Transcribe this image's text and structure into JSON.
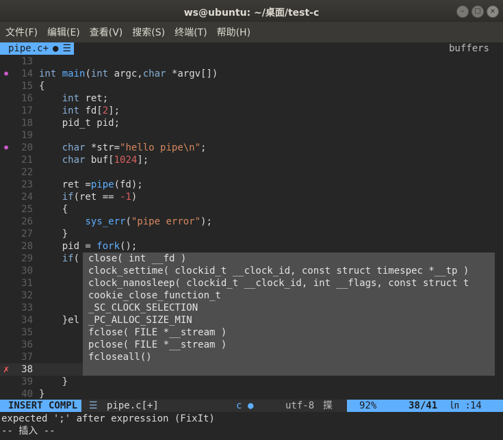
{
  "window": {
    "title": "ws@ubuntu: ~/桌面/test-c"
  },
  "menu": [
    "文件(F)",
    "编辑(E)",
    "查看(V)",
    "搜索(S)",
    "终端(T)",
    "帮助(H)"
  ],
  "tabline": {
    "active_tab": "pipe.c+",
    "right_label": "buffers"
  },
  "editor": {
    "lines": [
      {
        "num": "13",
        "sign": "",
        "tokens": []
      },
      {
        "num": "14",
        "sign": "warn",
        "tokens": [
          [
            "int ",
            "kw"
          ],
          [
            "main",
            "fn"
          ],
          [
            "(",
            "brk"
          ],
          [
            "int ",
            "kw"
          ],
          [
            "argc,",
            "t"
          ],
          [
            "char ",
            "kw"
          ],
          [
            "*argv[])",
            "t"
          ]
        ]
      },
      {
        "num": "15",
        "sign": "",
        "tokens": [
          [
            "{",
            "t"
          ]
        ]
      },
      {
        "num": "16",
        "sign": "",
        "tokens": [
          [
            "    ",
            "t"
          ],
          [
            "int ",
            "kw"
          ],
          [
            "ret;",
            "t"
          ]
        ]
      },
      {
        "num": "17",
        "sign": "",
        "tokens": [
          [
            "    ",
            "t"
          ],
          [
            "int ",
            "kw"
          ],
          [
            "fd[",
            "t"
          ],
          [
            "2",
            "num"
          ],
          [
            "];",
            "t"
          ]
        ]
      },
      {
        "num": "18",
        "sign": "",
        "tokens": [
          [
            "    pid_t pid;",
            "t"
          ]
        ]
      },
      {
        "num": "19",
        "sign": "",
        "tokens": []
      },
      {
        "num": "20",
        "sign": "warn",
        "tokens": [
          [
            "    ",
            "t"
          ],
          [
            "char ",
            "kw"
          ],
          [
            "*str=",
            "t"
          ],
          [
            "\"hello pipe\\n\"",
            "str"
          ],
          [
            ";",
            "t"
          ]
        ]
      },
      {
        "num": "21",
        "sign": "",
        "tokens": [
          [
            "    ",
            "t"
          ],
          [
            "char ",
            "kw"
          ],
          [
            "buf[",
            "t"
          ],
          [
            "1024",
            "num"
          ],
          [
            "];",
            "t"
          ]
        ]
      },
      {
        "num": "22",
        "sign": "",
        "tokens": []
      },
      {
        "num": "23",
        "sign": "",
        "tokens": [
          [
            "    ret =",
            "t"
          ],
          [
            "pipe",
            "fn"
          ],
          [
            "(fd);",
            "t"
          ]
        ]
      },
      {
        "num": "24",
        "sign": "",
        "tokens": [
          [
            "    ",
            "t"
          ],
          [
            "if",
            "kw"
          ],
          [
            "(ret == ",
            "t"
          ],
          [
            "-1",
            "num"
          ],
          [
            ")",
            "t"
          ]
        ]
      },
      {
        "num": "25",
        "sign": "",
        "tokens": [
          [
            "    {",
            "t"
          ]
        ]
      },
      {
        "num": "26",
        "sign": "",
        "tokens": [
          [
            "        ",
            "t"
          ],
          [
            "sys_err",
            "fn"
          ],
          [
            "(",
            "t"
          ],
          [
            "\"pipe error\"",
            "str"
          ],
          [
            ");",
            "t"
          ]
        ]
      },
      {
        "num": "27",
        "sign": "",
        "tokens": [
          [
            "    }",
            "t"
          ]
        ]
      },
      {
        "num": "28",
        "sign": "",
        "tokens": [
          [
            "    pid = ",
            "t"
          ],
          [
            "fork",
            "fn"
          ],
          [
            "();",
            "t"
          ]
        ]
      },
      {
        "num": "29",
        "sign": "",
        "tokens": [
          [
            "    ",
            "t"
          ],
          [
            "if",
            "kw"
          ],
          [
            "(",
            "t"
          ]
        ]
      },
      {
        "num": "30",
        "sign": "",
        "tokens": []
      },
      {
        "num": "31",
        "sign": "",
        "tokens": []
      },
      {
        "num": "32",
        "sign": "",
        "tokens": []
      },
      {
        "num": "33",
        "sign": "",
        "tokens": []
      },
      {
        "num": "34",
        "sign": "",
        "tokens": [
          [
            "    }el",
            "t"
          ]
        ]
      },
      {
        "num": "35",
        "sign": "",
        "tokens": []
      },
      {
        "num": "36",
        "sign": "",
        "tokens": []
      },
      {
        "num": "37",
        "sign": "",
        "tokens": []
      },
      {
        "num": "38",
        "sign": "err",
        "tokens": []
      },
      {
        "num": "39",
        "sign": "",
        "tokens": [
          [
            "    }",
            "t"
          ]
        ]
      },
      {
        "num": "40",
        "sign": "",
        "tokens": [
          [
            "}",
            "t"
          ]
        ]
      }
    ],
    "current_line": "38",
    "typed_text": "close"
  },
  "completion": [
    "close( int __fd )",
    "clock_settime( clockid_t __clock_id, const struct timespec *__tp )",
    "clock_nanosleep( clockid_t __clock_id, int __flags, const struct t",
    "cookie_close_function_t",
    "_SC_CLOCK_SELECTION",
    "_PC_ALLOC_SIZE_MIN",
    "fclose( FILE *__stream )",
    "pclose( FILE *__stream )",
    "fcloseall()"
  ],
  "statusline": {
    "mode": "INSERT COMPL",
    "file": "pipe.c[+]",
    "filetype": "c",
    "encoding": "utf-8",
    "format_icon": "揲",
    "percent": "92%",
    "position": "38/41",
    "col_label": "㏑ :",
    "col": "14"
  },
  "messages": {
    "error": "expected ';' after expression (FixIt)",
    "mode": "-- 插入 --"
  },
  "colors": {
    "accent": "#5fafff",
    "background": "#262626",
    "warn_sign": "#d75fd7",
    "error_sign": "#ff5f5f",
    "popup_bg": "#4e4e4e"
  }
}
